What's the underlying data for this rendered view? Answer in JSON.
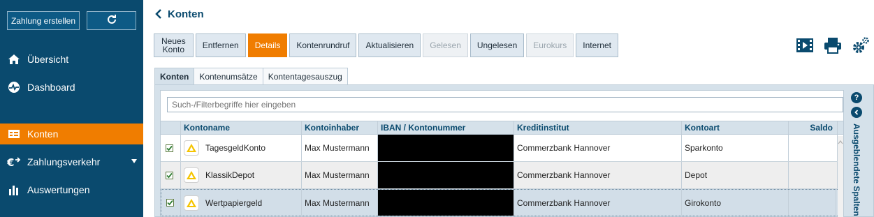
{
  "sidebar": {
    "create_payment": "Zahlung erstellen",
    "refresh_icon": "refresh-icon",
    "items": [
      {
        "label": "Übersicht",
        "icon": "home-icon"
      },
      {
        "label": "Dashboard",
        "icon": "dashboard-icon"
      },
      {
        "label": "Konten",
        "icon": "accounts-icon",
        "active": true
      },
      {
        "label": "Zahlungsverkehr",
        "icon": "payments-icon"
      },
      {
        "label": "Auswertungen",
        "icon": "chart-icon"
      }
    ]
  },
  "header": {
    "title": "Konten"
  },
  "toolbar": {
    "new_account_line1": "Neues",
    "new_account_line2": "Konto",
    "remove": "Entfernen",
    "details": "Details",
    "poll": "Kontenrundruf",
    "update": "Aktualisieren",
    "read": "Gelesen",
    "unread": "Ungelesen",
    "euro_rate": "Eurokurs",
    "internet": "Internet"
  },
  "tabs": [
    "Konten",
    "Kontenumsätze",
    "Kontentagesauszug"
  ],
  "grid": {
    "search_placeholder": "Such-/Filterbegriffe hier eingeben",
    "columns": [
      "Kontoname",
      "Kontoinhaber",
      "IBAN / Kontonummer",
      "Kreditinstitut",
      "Kontoart",
      "Saldo"
    ],
    "rows": [
      {
        "name": "TagesgeldKonto",
        "owner": "Max Mustermann",
        "iban": "",
        "bank": "Commerzbank Hannover",
        "type": "Sparkonto",
        "balance": ""
      },
      {
        "name": "KlassikDepot",
        "owner": "Max Mustermann",
        "iban": "",
        "bank": "Commerzbank Hannover",
        "type": "Depot",
        "balance": ""
      },
      {
        "name": "Wertpapiergeld",
        "owner": "Max Mustermann",
        "iban": "",
        "bank": "Commerzbank Hannover",
        "type": "Girokonto",
        "balance": ""
      }
    ],
    "hidden_columns_label": "Ausgeblendete Spalten",
    "help_icon": "?"
  },
  "colors": {
    "sidebar": "#0a4a6e",
    "accent": "#f07d00",
    "panel": "#d5e1ea"
  }
}
